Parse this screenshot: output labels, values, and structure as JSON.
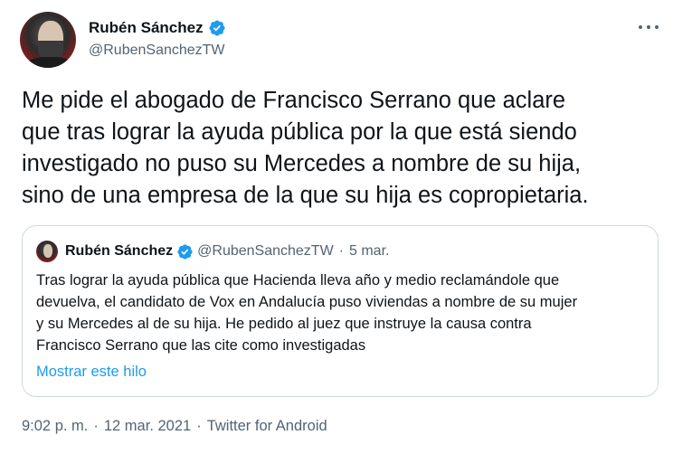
{
  "author": {
    "display_name": "Rubén Sánchez",
    "handle": "@RubenSanchezTW",
    "verified": true
  },
  "tweet": {
    "text": "Me pide el abogado de Francisco Serrano que aclare\nque tras lograr la ayuda pública por la que está siendo\ninvestigado no puso su Mercedes a nombre de su hija,\nsino de una empresa de la que su hija es copropietaria."
  },
  "quoted_tweet": {
    "display_name": "Rubén Sánchez",
    "handle": "@RubenSanchezTW",
    "separator": "·",
    "date": "5 mar.",
    "text": "Tras lograr la ayuda pública que Hacienda lleva año y medio reclamándole que\ndevuelva, el candidato de Vox en Andalucía puso viviendas a nombre de su mujer\ny su Mercedes al de su hija. He pedido al juez que instruye la causa contra\nFrancisco Serrano que las cite como investigadas",
    "show_thread_label": "Mostrar este hilo"
  },
  "meta": {
    "time": "9:02 p. m.",
    "separator": "·",
    "date": "12 mar. 2021",
    "source": "Twitter for Android"
  },
  "icons": {
    "verified": "verified-badge-icon",
    "more": "more-options-icon"
  },
  "colors": {
    "accent": "#1d9bf0",
    "text": "#0f1419",
    "secondary": "#536471",
    "border": "#cfd9de"
  }
}
